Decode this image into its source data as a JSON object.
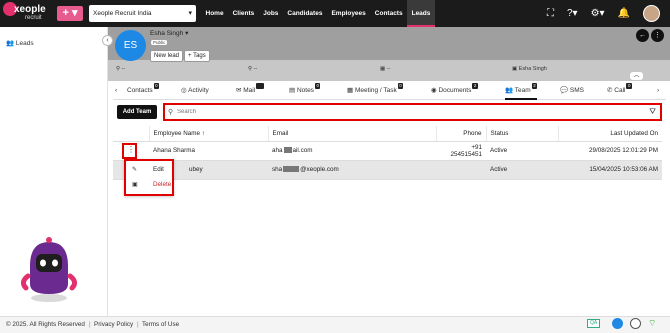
{
  "brand": {
    "name": "xeople",
    "sub": "recruit",
    "plus_label": "+ ▾"
  },
  "topbar": {
    "company": "Xeople Recruit India",
    "nav": [
      "Home",
      "Clients",
      "Jobs",
      "Candidates",
      "Employees",
      "Contacts",
      "Leads"
    ],
    "active_nav": "Leads",
    "icons": [
      "fullscreen-icon",
      "help-icon",
      "settings-icon",
      "bell-icon",
      "user-avatar"
    ]
  },
  "sidebar": {
    "items": [
      {
        "label": "Leads",
        "icon": "people-icon"
      }
    ]
  },
  "lead": {
    "initials": "ES",
    "name": "Esha Singh",
    "visibility": "Public",
    "new_lead_label": "New lead",
    "tags_label": "+ Tags",
    "info": [
      "--",
      "--",
      "--",
      "Esha Singh"
    ]
  },
  "tabs": [
    {
      "label": "Contacts",
      "count": "0"
    },
    {
      "label": "Activity",
      "count": ""
    },
    {
      "label": "Mail",
      "count": ""
    },
    {
      "label": "Notes",
      "count": "0"
    },
    {
      "label": "Meeting / Task",
      "count": "0"
    },
    {
      "label": "Documents",
      "count": "2"
    },
    {
      "label": "Team",
      "count": "2"
    },
    {
      "label": "SMS",
      "count": ""
    },
    {
      "label": "Call",
      "count": "0"
    }
  ],
  "toolbar": {
    "add_team_label": "Add Team",
    "search_placeholder": "Search"
  },
  "table": {
    "columns": [
      "Employee Name ↑",
      "Email",
      "Phone",
      "Status",
      "Last Updated On"
    ],
    "rows": [
      {
        "name": "Ahana Sharma",
        "email_prefix": "aha",
        "email_suffix": "ail.com",
        "phone": "+91 254515451",
        "status": "Active",
        "updated": "29/08/2025 12:01:29 PM"
      },
      {
        "name": "ubey",
        "email_prefix": "sha",
        "email_suffix": "@xeople.com",
        "phone": "",
        "status": "Active",
        "updated": "15/04/2025 10:53:06 AM"
      }
    ]
  },
  "row_menu": {
    "edit_label": "Edit",
    "delete_label": "Delete"
  },
  "footer": {
    "copyright": "© 2025. All Rights Reserved",
    "privacy": "Privacy Policy",
    "terms": "Terms of Use",
    "qa": "QA"
  }
}
